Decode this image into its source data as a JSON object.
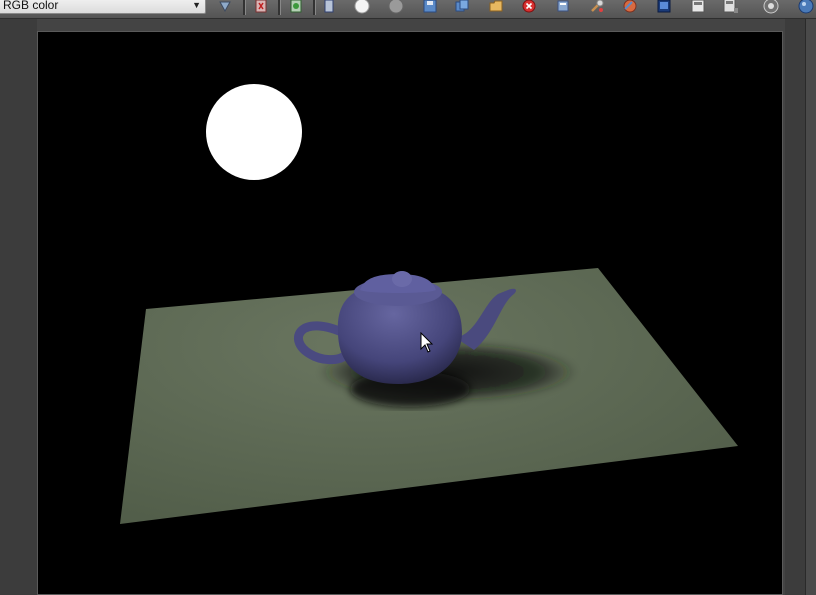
{
  "toolbar": {
    "channel_label": "RGB color",
    "buttons": [
      {
        "name": "display-alpha-icon"
      },
      {
        "name": "red-channel-icon"
      },
      {
        "name": "green-channel-icon"
      },
      {
        "name": "blue-channel-icon"
      },
      {
        "name": "white-swatch-icon"
      },
      {
        "name": "gray-swatch-icon"
      },
      {
        "name": "save-image-icon"
      },
      {
        "name": "copy-image-icon"
      },
      {
        "name": "clone-frame-icon"
      },
      {
        "name": "clear-icon"
      },
      {
        "name": "print-icon"
      },
      {
        "name": "tools-icon"
      },
      {
        "name": "color-picker-icon"
      },
      {
        "name": "display-icon"
      },
      {
        "name": "panel-icon"
      },
      {
        "name": "panel-options-icon"
      },
      {
        "name": "settings-icon"
      },
      {
        "name": "render-icon"
      }
    ]
  },
  "scene": {
    "floor_color": "#5f6b55",
    "teapot_color": "#4a4a7c",
    "light_color": "#ffffff",
    "background_color": "#000000"
  }
}
